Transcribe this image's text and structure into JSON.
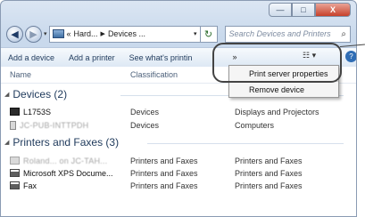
{
  "window": {
    "minimize_glyph": "—",
    "maximize_glyph": "□",
    "close_glyph": "X"
  },
  "nav": {
    "back_glyph": "◀",
    "forward_glyph": "▶",
    "history_glyph": "▾",
    "address_prefix": "«",
    "address_crumbs": [
      "Hard...",
      "Devices ..."
    ],
    "address_sep": "▶",
    "address_dropdown_glyph": "▾",
    "refresh_glyph": "↻",
    "search_placeholder": "Search Devices and Printers",
    "search_icon_glyph": "⌕"
  },
  "toolbar": {
    "add_device": "Add a device",
    "add_printer": "Add a printer",
    "see_whats_printing": "See what's printin",
    "overflow_glyph": "»",
    "view_glyph": "☷ ▾",
    "help_glyph": "?"
  },
  "columns": {
    "name": "Name",
    "classification": "Classification"
  },
  "groups": {
    "devices": {
      "label": "Devices (2)",
      "arrow": "◢"
    },
    "printers": {
      "label": "Printers and Faxes (3)",
      "arrow": "◢"
    }
  },
  "devices": [
    {
      "name": "L1753S",
      "classification": "Devices",
      "category": "Displays and Projectors",
      "icon": "monitor-icon"
    },
    {
      "name": "JC-PUB-INTTPDH",
      "classification": "Devices",
      "category": "Computers",
      "icon": "computer-icon",
      "blurred": true
    }
  ],
  "printers": [
    {
      "name": "Roland... on JC-TAH...",
      "classification": "Printers and Faxes",
      "category": "Printers and Faxes",
      "icon": "printer-icon",
      "blurred": true
    },
    {
      "name": "Microsoft XPS Docume...",
      "classification": "Printers and Faxes",
      "category": "Printers and Faxes",
      "icon": "printer-icon"
    },
    {
      "name": "Fax",
      "classification": "Printers and Faxes",
      "category": "Printers and Faxes",
      "icon": "fax-icon"
    }
  ],
  "menu": {
    "items": [
      "Print server properties",
      "Remove device"
    ]
  },
  "colors": {
    "title_blue": "#1e395b",
    "window_frame": "#c9d9ec",
    "close_red": "#c7402a"
  }
}
